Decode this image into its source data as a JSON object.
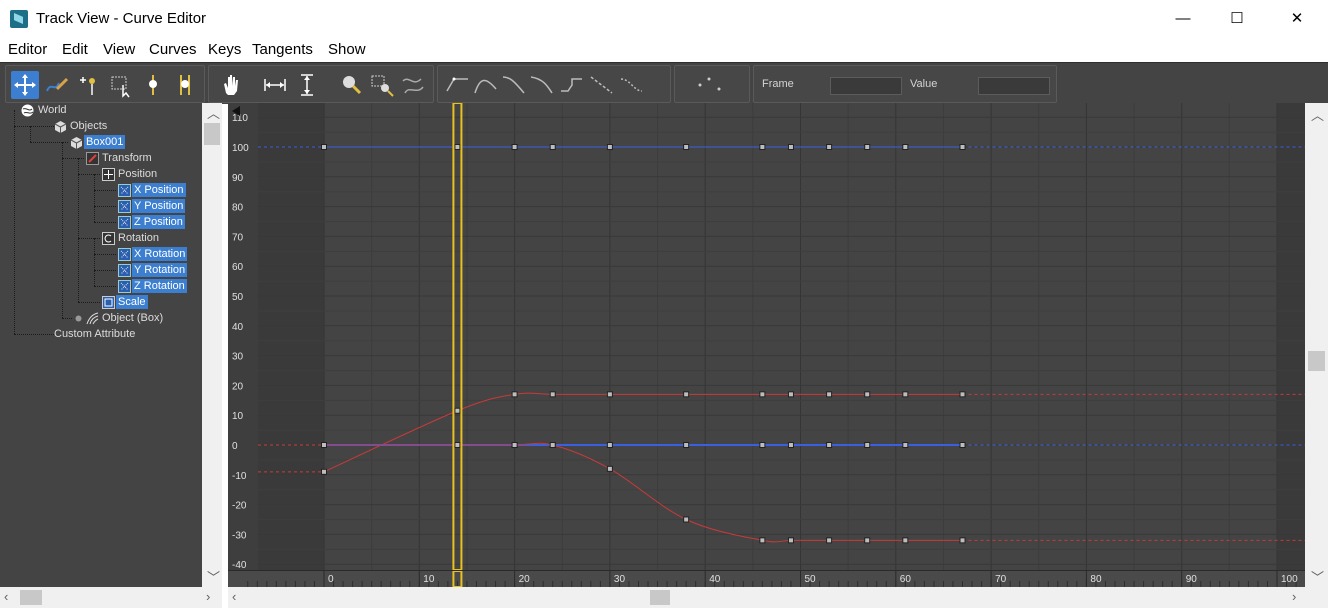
{
  "window": {
    "title": "Track View - Curve Editor",
    "minimize": "—",
    "maximize": "☐",
    "close": "✕"
  },
  "menu": [
    "Editor",
    "Edit",
    "View",
    "Curves",
    "Keys",
    "Tangents",
    "Show"
  ],
  "toolbar": {
    "buttons": [
      {
        "name": "move-keys-icon",
        "active": true
      },
      {
        "name": "draw-curves-icon",
        "active": false
      },
      {
        "name": "add-keys-icon",
        "active": false
      },
      {
        "name": "region-tool-icon",
        "active": false
      },
      {
        "name": "retime-tool-icon",
        "active": false
      },
      {
        "name": "retime-all-tool-icon",
        "active": false
      },
      {
        "name": "pan-hand-icon",
        "active": false
      },
      {
        "name": "frame-horizontal-extents-icon",
        "active": false
      },
      {
        "name": "frame-value-extents-icon",
        "active": false
      },
      {
        "name": "zoom-icon",
        "active": false
      },
      {
        "name": "zoom-region-icon",
        "active": false
      },
      {
        "name": "isolate-curve-icon",
        "active": false
      },
      {
        "name": "auto-tangent-icon",
        "active": false
      },
      {
        "name": "spline-tangent-icon",
        "active": false
      },
      {
        "name": "fast-tangent-icon",
        "active": false
      },
      {
        "name": "slow-tangent-icon",
        "active": false
      },
      {
        "name": "stepped-tangent-icon",
        "active": false
      },
      {
        "name": "linear-tangent-icon",
        "active": false
      },
      {
        "name": "smooth-tangent-icon",
        "active": false
      },
      {
        "name": "show-keys-icon",
        "active": false
      }
    ],
    "frame_label": "Frame",
    "frame_value": "",
    "value_label": "Value",
    "value_value": ""
  },
  "tree": [
    {
      "label": "World",
      "icon": "world-icon",
      "selected": false
    },
    {
      "label": "Objects",
      "icon": "objects-icon",
      "selected": false
    },
    {
      "label": "Box001",
      "icon": "box-icon",
      "selected": true
    },
    {
      "label": "Transform",
      "icon": "transform-icon",
      "selected": false
    },
    {
      "label": "Position",
      "icon": "position-icon",
      "selected": false
    },
    {
      "label": "X Position",
      "icon": "track-icon",
      "selected": true
    },
    {
      "label": "Y Position",
      "icon": "track-icon",
      "selected": true
    },
    {
      "label": "Z Position",
      "icon": "track-icon",
      "selected": true
    },
    {
      "label": "Rotation",
      "icon": "rotation-icon",
      "selected": false
    },
    {
      "label": "X Rotation",
      "icon": "track-icon",
      "selected": true
    },
    {
      "label": "Y Rotation",
      "icon": "track-icon",
      "selected": true
    },
    {
      "label": "Z Rotation",
      "icon": "track-icon",
      "selected": true
    },
    {
      "label": "Scale",
      "icon": "scale-icon",
      "selected": true
    },
    {
      "label": "Object (Box)",
      "icon": "object-icon",
      "selected": false
    },
    {
      "label": "Custom Attribute",
      "icon": "",
      "selected": false
    }
  ],
  "graph": {
    "value_ticks": [
      110,
      100,
      90,
      80,
      70,
      60,
      50,
      40,
      30,
      20,
      10,
      0,
      -10,
      -20,
      -30,
      -40
    ],
    "frame_ticks": [
      0,
      10,
      20,
      30,
      40,
      50,
      60,
      70,
      80,
      90,
      100
    ],
    "active_range": [
      0,
      100
    ],
    "current_frame": 14,
    "key_frames": [
      0,
      14,
      20,
      24,
      30,
      38,
      46,
      49,
      53,
      57,
      61,
      67
    ],
    "curves": [
      {
        "name": "blue-top-curve",
        "color": "#3a5fe0",
        "values": [
          100,
          100,
          100,
          100,
          100,
          100,
          100,
          100,
          100,
          100,
          100,
          100
        ]
      },
      {
        "name": "red-upper-curve",
        "color": "#c93a3a",
        "values": [
          -9,
          11.5,
          17,
          17,
          17,
          17,
          17,
          17,
          17,
          17,
          17,
          17
        ]
      },
      {
        "name": "blue-zero-curve",
        "color": "#3a5fe0",
        "values": [
          0,
          0,
          0,
          0,
          0,
          0,
          0,
          0,
          0,
          0,
          0,
          0
        ]
      },
      {
        "name": "red-lower-curve",
        "color": "#c93a3a",
        "values": [
          0,
          0,
          0,
          0,
          -8,
          -25,
          -32,
          -32,
          -32,
          -32,
          -32,
          -32
        ]
      }
    ]
  }
}
